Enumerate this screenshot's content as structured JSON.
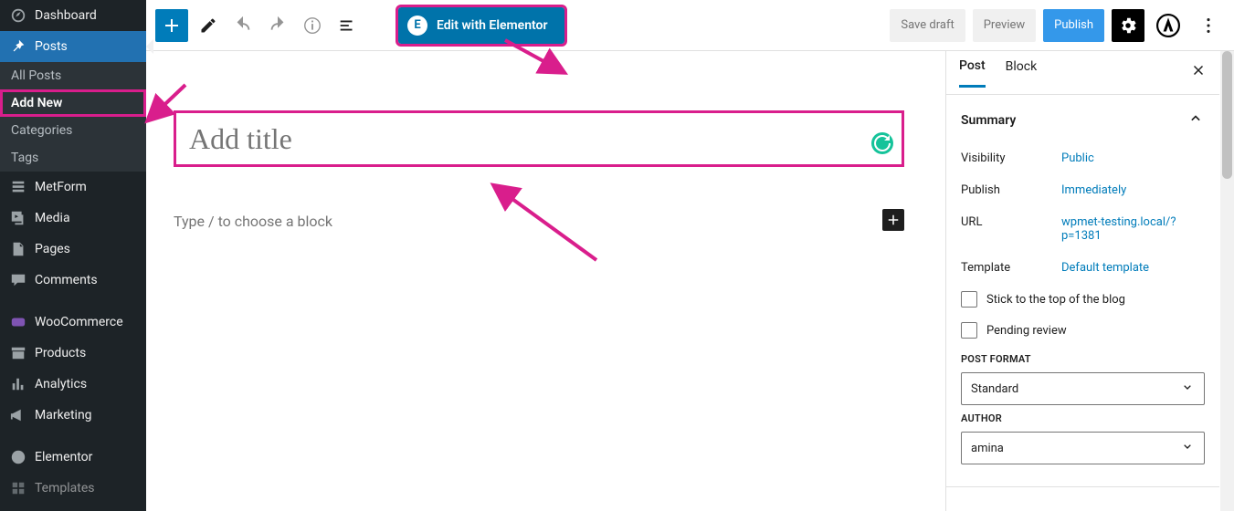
{
  "sidebar": {
    "dashboard": "Dashboard",
    "posts": "Posts",
    "posts_sub": {
      "all": "All Posts",
      "add_new": "Add New",
      "categories": "Categories",
      "tags": "Tags"
    },
    "metform": "MetForm",
    "media": "Media",
    "pages": "Pages",
    "comments": "Comments",
    "woocommerce": "WooCommerce",
    "products": "Products",
    "analytics": "Analytics",
    "marketing": "Marketing",
    "elementor": "Elementor",
    "templates": "Templates"
  },
  "topbar": {
    "elementor_btn": "Edit with Elementor",
    "save_draft": "Save draft",
    "preview": "Preview",
    "publish": "Publish"
  },
  "editor": {
    "title_placeholder": "Add title",
    "default_block_placeholder": "Type / to choose a block"
  },
  "settings": {
    "tabs": {
      "post": "Post",
      "block": "Block"
    },
    "summary": {
      "label": "Summary",
      "visibility_k": "Visibility",
      "visibility_v": "Public",
      "publish_k": "Publish",
      "publish_v": "Immediately",
      "url_k": "URL",
      "url_v": "wpmet-testing.local/?p=1381",
      "template_k": "Template",
      "template_v": "Default template",
      "stick_top": "Stick to the top of the blog",
      "pending": "Pending review"
    },
    "post_format": {
      "label": "POST FORMAT",
      "value": "Standard"
    },
    "author": {
      "label": "AUTHOR",
      "value": "amina"
    }
  }
}
